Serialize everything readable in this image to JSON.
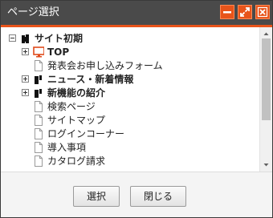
{
  "window": {
    "title": "ページ選択",
    "accent_color": "#e8541a",
    "titlebar_color": "#4a4a4a",
    "controls": [
      {
        "icon": "minimize-icon"
      },
      {
        "icon": "maximize-icon"
      },
      {
        "icon": "close-icon"
      }
    ]
  },
  "tree": {
    "items": [
      {
        "label": "サイト初期",
        "state": "expanded",
        "icon": "site-folder-icon",
        "bold": true
      },
      {
        "label": "TOP",
        "state": "collapsed",
        "icon": "monitor-icon",
        "bold": true
      },
      {
        "label": "発表会お申し込みフォーム",
        "state": "leaf",
        "icon": "page-icon",
        "bold": false
      },
      {
        "label": "ニュース・新着情報",
        "state": "collapsed",
        "icon": "folder-icon",
        "bold": true
      },
      {
        "label": "新機能の紹介",
        "state": "collapsed",
        "icon": "folder-icon",
        "bold": true
      },
      {
        "label": "検索ページ",
        "state": "leaf",
        "icon": "page-icon",
        "bold": false
      },
      {
        "label": "サイトマップ",
        "state": "leaf",
        "icon": "page-icon",
        "bold": false
      },
      {
        "label": "ログインコーナー",
        "state": "leaf",
        "icon": "page-icon",
        "bold": false
      },
      {
        "label": "導入事項",
        "state": "leaf",
        "icon": "page-icon",
        "bold": false
      },
      {
        "label": "カタログ請求",
        "state": "leaf",
        "icon": "page-icon",
        "bold": false
      }
    ]
  },
  "footer": {
    "select_label": "選択",
    "close_label": "閉じる"
  }
}
